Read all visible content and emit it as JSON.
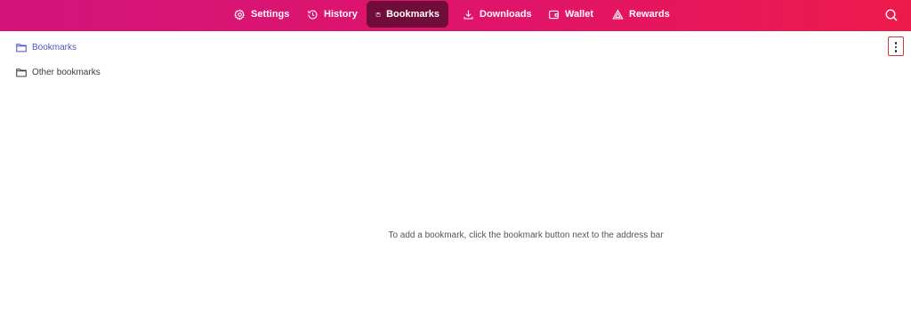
{
  "colors": {
    "bar_gradient_start": "#d3137a",
    "bar_gradient_end": "#ee1a4b",
    "active_tab": "#6f0c3a",
    "selected_folder": "#4a55c5"
  },
  "nav": {
    "items": [
      {
        "label": "Settings",
        "icon": "gear-icon"
      },
      {
        "label": "History",
        "icon": "history-icon"
      },
      {
        "label": "Bookmarks",
        "icon": "bookmark-icon",
        "active": true
      },
      {
        "label": "Downloads",
        "icon": "download-icon"
      },
      {
        "label": "Wallet",
        "icon": "wallet-icon"
      },
      {
        "label": "Rewards",
        "icon": "rewards-triangle-icon"
      }
    ],
    "search_icon": "search-icon"
  },
  "tree": {
    "items": [
      {
        "label": "Bookmarks",
        "icon": "folder-icon",
        "selected": true
      },
      {
        "label": "Other bookmarks",
        "icon": "folder-icon",
        "selected": false
      }
    ]
  },
  "menu": {
    "icon": "more-vertical-icon"
  },
  "empty_message": "To add a bookmark, click the bookmark button next to the address bar"
}
